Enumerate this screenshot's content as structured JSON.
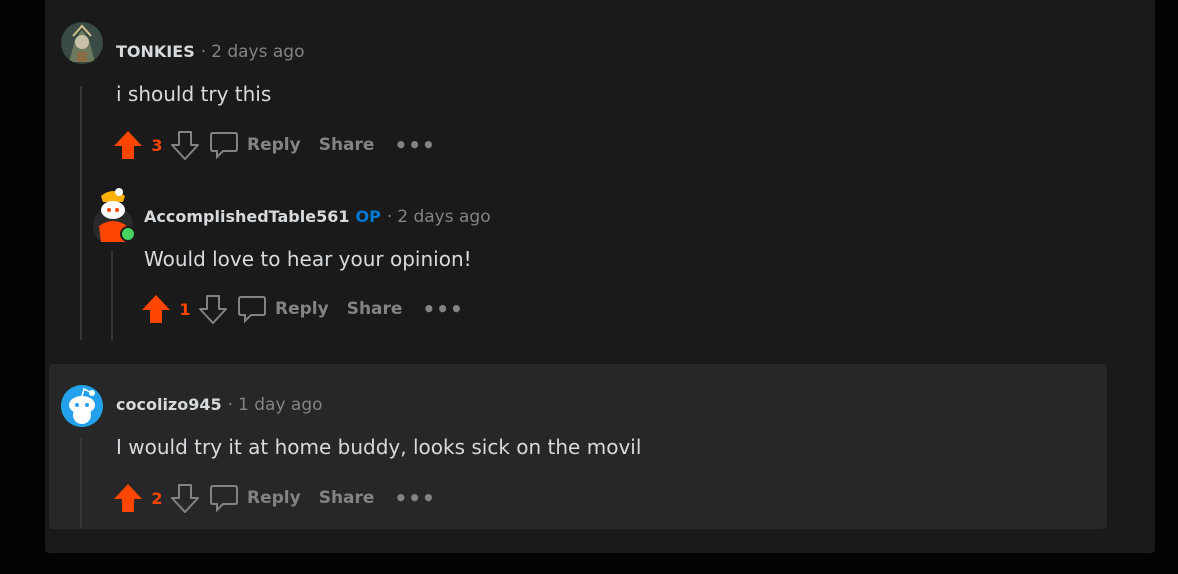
{
  "comments": [
    {
      "username": "TONKIES",
      "op": "",
      "time": "2 days ago",
      "text": "i should try this",
      "score": "3",
      "reply_label": "Reply",
      "share_label": "Share",
      "more_label": "•••"
    },
    {
      "username": "AccomplishedTable561",
      "op": "OP",
      "time": "2 days ago",
      "text": "Would love to hear your opinion!",
      "score": "1",
      "reply_label": "Reply",
      "share_label": "Share",
      "more_label": "•••"
    },
    {
      "username": "cocolizo945",
      "op": "",
      "time": "1 day ago",
      "text": "I would try it at home buddy, looks sick on the movil",
      "score": "2",
      "reply_label": "Reply",
      "share_label": "Share",
      "more_label": "•••"
    }
  ],
  "separator": "·",
  "icons": [
    "upvote-icon",
    "downvote-icon",
    "comment-bubble-icon",
    "more-options-icon"
  ],
  "colors": {
    "upvote_active": "#ff4500",
    "op_badge": "#0079d3",
    "online": "#46d160",
    "panel": "#1a1a1b",
    "highlight": "#272729"
  }
}
